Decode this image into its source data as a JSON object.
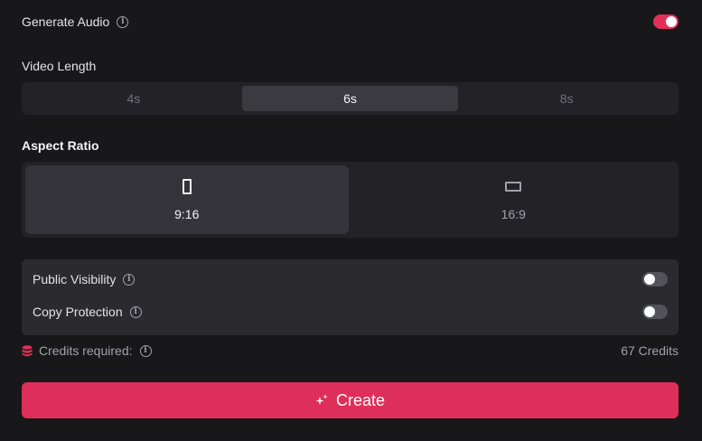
{
  "generate_audio": {
    "label": "Generate Audio",
    "enabled": true
  },
  "video_length": {
    "label": "Video Length",
    "options": [
      "4s",
      "6s",
      "8s"
    ],
    "selected": "6s"
  },
  "aspect_ratio": {
    "label": "Aspect Ratio",
    "options": [
      {
        "label": "9:16",
        "icon": "portrait-rect-icon"
      },
      {
        "label": "16:9",
        "icon": "landscape-rect-icon"
      }
    ],
    "selected": "9:16"
  },
  "public_visibility": {
    "label": "Public Visibility",
    "enabled": false
  },
  "copy_protection": {
    "label": "Copy Protection",
    "enabled": false
  },
  "credits": {
    "label": "Credits required:",
    "value": "67 Credits",
    "icon": "database-icon"
  },
  "create_button": {
    "label": "Create",
    "icon": "sparkle-icon"
  },
  "colors": {
    "accent": "#de2f5a",
    "background": "#18181b",
    "panel": "#232327"
  }
}
